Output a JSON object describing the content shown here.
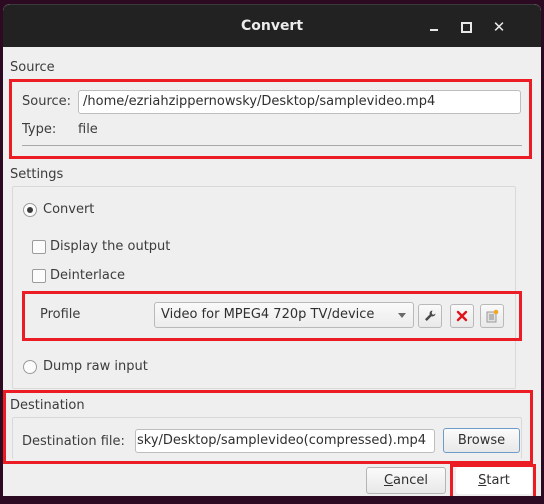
{
  "window": {
    "title": "Convert",
    "controls": {
      "minimize_icon": "minimize-icon",
      "maximize_icon": "maximize-icon",
      "close_icon": "close-icon",
      "close_glyph": "✕"
    }
  },
  "source": {
    "section_title": "Source",
    "source_label": "Source:",
    "source_value": "/home/ezriahzippernowsky/Desktop/samplevideo.mp4",
    "type_label": "Type:",
    "type_value": "file"
  },
  "settings": {
    "section_title": "Settings",
    "convert_label": "Convert",
    "convert_selected": true,
    "display_output_label": "Display the output",
    "display_output_checked": false,
    "deinterlace_label": "Deinterlace",
    "deinterlace_checked": false,
    "profile_label": "Profile",
    "profile_selected": "Video for MPEG4 720p TV/device",
    "profile_buttons": [
      {
        "name": "edit-profile",
        "icon": "wrench-icon"
      },
      {
        "name": "delete-profile",
        "icon": "delete-x-icon"
      },
      {
        "name": "new-profile",
        "icon": "new-profile-icon"
      }
    ],
    "dump_raw_label": "Dump raw input",
    "dump_raw_selected": false
  },
  "destination": {
    "section_title": "Destination",
    "file_label": "Destination file:",
    "file_value": "sky/Desktop/samplevideo(compressed).mp4",
    "browse_label": "Browse"
  },
  "footer": {
    "cancel_mnemonic": "C",
    "cancel_rest": "ancel",
    "start_mnemonic": "S",
    "start_rest": "tart"
  },
  "colors": {
    "highlight_box": "#ec1c24",
    "titlebar": "#222222",
    "dialog_bg": "#efefef",
    "delete_icon": "#e0161b",
    "new_profile_dot": "#f5a623"
  }
}
